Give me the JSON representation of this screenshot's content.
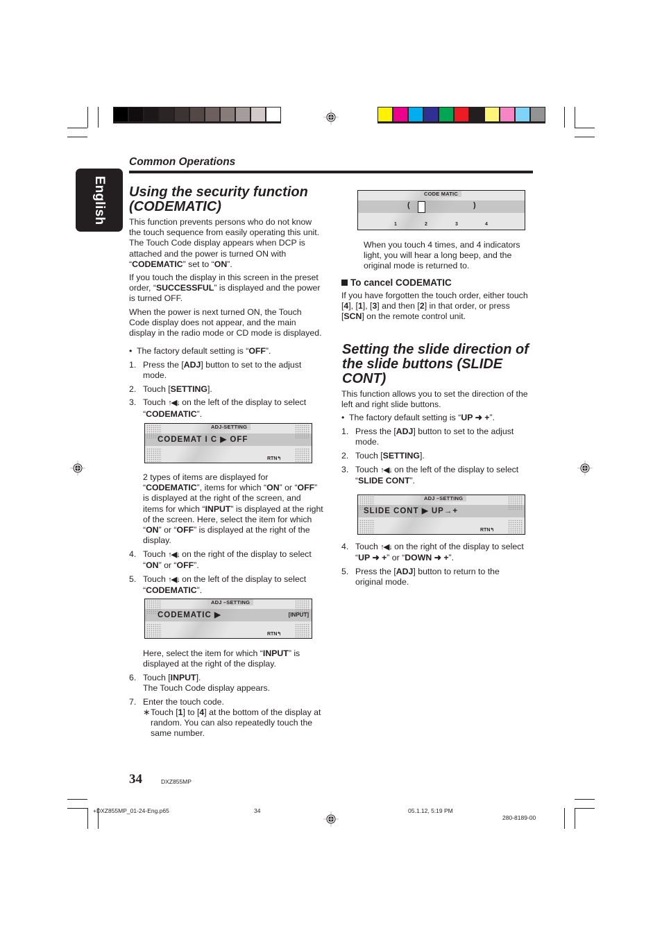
{
  "print_marks": {
    "gray_swatches": [
      "#000000",
      "#0f0d0d",
      "#1c1819",
      "#2b2526",
      "#3c3333",
      "#544847",
      "#6c5f5d",
      "#877c7a",
      "#a59d9b",
      "#d2cac9",
      "#ffffff"
    ],
    "color_swatches": [
      "#fff200",
      "#ec008c",
      "#00aeef",
      "#2e3192",
      "#00a651",
      "#ed1c24",
      "#231f20",
      "#fff57a",
      "#f585c4",
      "#7fd3f7",
      "#939393"
    ]
  },
  "language_tab": "English",
  "section_label": "Common Operations",
  "left": {
    "title_line1": "Using the security function",
    "title_line2": "(CODEMATIC)",
    "intro": {
      "p1_a": "This function prevents persons who do not know the touch sequence from easily operating this unit. The Touch Code display appears when DCP is attached and the power is turned ON with “",
      "p1_b": "CODEMATIC",
      "p1_c": "” set to “",
      "p1_d": "ON",
      "p1_e": "”.",
      "p2_a": "If you touch the display in this screen in the preset order, “",
      "p2_b": "SUCCESSFUL",
      "p2_c": "” is displayed and the power is turned OFF.",
      "p3": "When the power is next turned ON, the Touch Code display does not appear, and the main display in the radio mode or CD mode is displayed."
    },
    "bullet": {
      "a": "The factory default setting is “",
      "b": "OFF",
      "c": "”."
    },
    "steps": [
      {
        "num": "1.",
        "a": "Press the [",
        "b": "ADJ",
        "c": "] button to set to the adjust mode."
      },
      {
        "num": "2.",
        "a": "Touch [",
        "b": "SETTING",
        "c": "]."
      },
      {
        "num": "3.",
        "a": "Touch ",
        "glyph": "↑◀↓",
        "c": " on the left of the display to select “",
        "d": "CODEMATIC",
        "e": "”."
      }
    ],
    "lcd1": {
      "header": "ADJ-SETTING",
      "main": "CODEMAT I C  ▶  OFF",
      "rtn": "RTN↰"
    },
    "explain": {
      "a": "2 types of items are displayed for “",
      "b": "CODEMATIC",
      "c": "”, items for which “",
      "d": "ON",
      "e": "” or “",
      "f": "OFF",
      "g": "” is displayed at the right of the screen, and items for which “",
      "h": "INPUT",
      "i": "” is displayed at the right of the screen. Here, select the item for which “",
      "j": "ON",
      "k": "” or “",
      "l": "OFF",
      "m": "” is displayed at the right of the display."
    },
    "step4": {
      "num": "4.",
      "a": "Touch ",
      "glyph": "↑◀↓",
      "c": " on the right of the display to select “",
      "d": "ON",
      "e": "” or “",
      "f": "OFF",
      "g": "”."
    },
    "step5": {
      "num": "5.",
      "a": "Touch ",
      "glyph": "↑◀↓",
      "c": " on the left of the display to select “",
      "d": "CODEMATIC",
      "e": "”."
    },
    "lcd2": {
      "header": "ADJ –SETTING",
      "main": "CODEMATIC  ▶",
      "right": "[INPUT]",
      "rtn": "RTN↰"
    },
    "here": {
      "a": "Here, select the item for which “",
      "b": "INPUT",
      "c": "” is displayed at the right of the display."
    },
    "step6": {
      "num": "6.",
      "a": "Touch [",
      "b": "INPUT",
      "c": "].",
      "line2": "The Touch Code display appears."
    },
    "step7": {
      "num": "7.",
      "text": "Enter the touch code."
    },
    "note": {
      "star": "∗",
      "a": "Touch [",
      "b": "1",
      "c": "] to [",
      "d": "4",
      "e": "] at the bottom of the display at random. You can also repeatedly touch the same number."
    }
  },
  "right": {
    "lcd3": {
      "header": "CODE MATIC",
      "lt": "(",
      "gt": ")",
      "nums": [
        "1",
        "2",
        "3",
        "4"
      ]
    },
    "after_code": "When you touch 4 times, and 4 indicators light, you will hear a long beep, and the original mode is returned to.",
    "cancel": {
      "title": "To cancel CODEMATIC",
      "a": "If you have forgotten the touch order, either touch [",
      "b": "4",
      "c": "], [",
      "d": "1",
      "e": "], [",
      "f": "3",
      "g": "] and then [",
      "h": "2",
      "i": "] in that order, or press [",
      "j": "SCN",
      "k": "] on the remote control unit."
    },
    "title2": "Setting the slide direction of the slide buttons (SLIDE CONT)",
    "intro2": "This function allows you to set the direction of the left and right slide buttons.",
    "bullet2": {
      "a": "The factory default setting is “",
      "b": "UP ➜ +",
      "c": "”."
    },
    "steps": [
      {
        "num": "1.",
        "a": "Press the [",
        "b": "ADJ",
        "c": "] button to set to the adjust mode."
      },
      {
        "num": "2.",
        "a": "Touch [",
        "b": "SETTING",
        "c": "]."
      },
      {
        "num": "3.",
        "a": "Touch ",
        "glyph": "↑◀↓",
        "c": " on the left of the display to select “",
        "d": "SLIDE CONT",
        "e": "”."
      }
    ],
    "lcd4": {
      "header": "ADJ –SETTING",
      "main": "SLIDE  CONT  ▶  UP→+",
      "rtn": "RTN↰"
    },
    "step4": {
      "num": "4.",
      "a": "Touch ",
      "glyph": "↑◀↓",
      "c": " on the right of the display to select “",
      "d": "UP ➜ +",
      "e": "”  or “",
      "f": "DOWN ➜ +",
      "g": "”."
    },
    "step5": {
      "num": "5.",
      "a": "Press the [",
      "b": "ADJ",
      "c": "] button to return to the original mode."
    }
  },
  "footer": {
    "page_number": "34",
    "model": "DXZ855MP",
    "file_name": "+DXZ855MP_01-24-Eng.p65",
    "file_page": "34",
    "date_time": "05.1.12, 5:19 PM",
    "part_number": "280-8189-00"
  }
}
